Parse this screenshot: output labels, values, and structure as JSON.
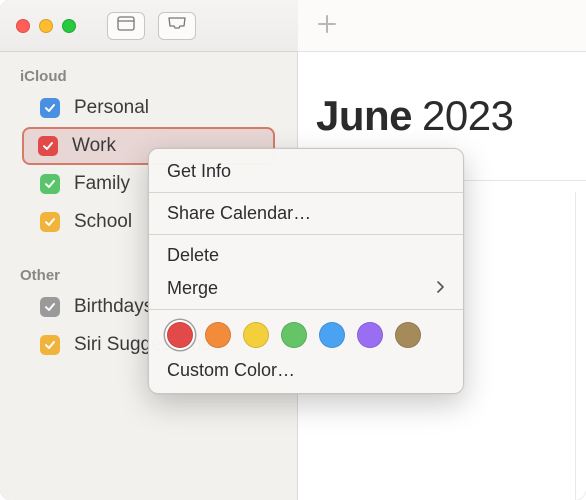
{
  "titlebar": {
    "traffic": [
      "close",
      "minimize",
      "zoom"
    ]
  },
  "sidebar": {
    "sections": [
      {
        "header": "iCloud",
        "items": [
          {
            "label": "Personal",
            "color": "#4a90e2",
            "checked": true,
            "selected": false
          },
          {
            "label": "Work",
            "color": "#e24a4a",
            "checked": true,
            "selected": true
          },
          {
            "label": "Family",
            "color": "#5ac46b",
            "checked": true,
            "selected": false
          },
          {
            "label": "School",
            "color": "#f0b43c",
            "checked": true,
            "selected": false
          }
        ]
      },
      {
        "header": "Other",
        "items": [
          {
            "label": "Birthdays",
            "color": "#9a9a9a",
            "checked": true,
            "selected": false
          },
          {
            "label": "Siri Suggestions",
            "color": "#f0b43c",
            "checked": true,
            "selected": false
          }
        ]
      }
    ]
  },
  "main": {
    "month": "June",
    "year": "2023"
  },
  "context_menu": {
    "items": {
      "get_info": "Get Info",
      "share": "Share Calendar…",
      "delete": "Delete",
      "merge": "Merge",
      "custom_color": "Custom Color…"
    },
    "colors": [
      {
        "hex": "#e24a4a",
        "selected": true
      },
      {
        "hex": "#f28c3b",
        "selected": false
      },
      {
        "hex": "#f2cf3b",
        "selected": false
      },
      {
        "hex": "#64c466",
        "selected": false
      },
      {
        "hex": "#4aa3f2",
        "selected": false
      },
      {
        "hex": "#9a6ef2",
        "selected": false
      },
      {
        "hex": "#a58a5a",
        "selected": false
      }
    ]
  }
}
